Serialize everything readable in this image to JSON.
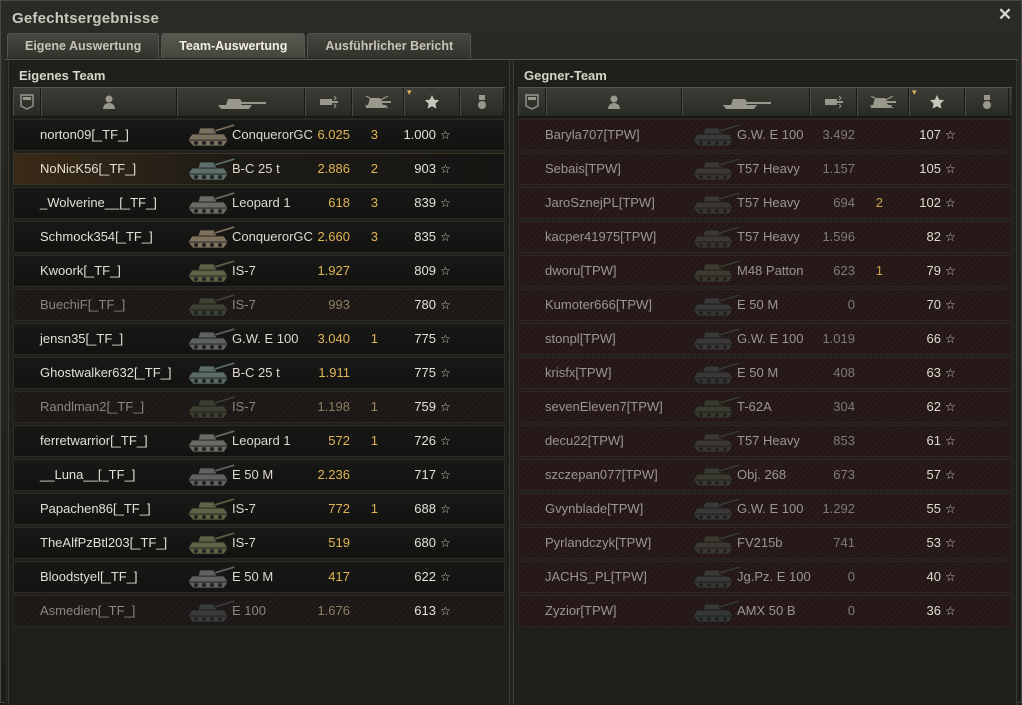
{
  "window": {
    "title": "Gefechtsergebnisse"
  },
  "tabs": [
    {
      "label": "Eigene Auswertung",
      "active": false
    },
    {
      "label": "Team-Auswertung",
      "active": true
    },
    {
      "label": "Ausführlicher Bericht",
      "active": false
    }
  ],
  "header_icons": [
    "squad-icon",
    "player-icon",
    "vehicle-icon",
    "damage-icon",
    "frags-icon",
    "experience-star-icon",
    "medal-icon"
  ],
  "sort": {
    "column": "experience",
    "indicator": "▾"
  },
  "star_glyph": "☆",
  "own_team": {
    "title": "Eigenes Team",
    "players": [
      {
        "name": "norton09[_TF_]",
        "vehicle": "ConquerorGC",
        "damage": "6.025",
        "kills": "3",
        "xp": "1.000",
        "state": "alive",
        "tank_color": "#7a705e"
      },
      {
        "name": "NoNicK56[_TF_]",
        "vehicle": "B-C 25 t",
        "damage": "2.886",
        "kills": "2",
        "xp": "903",
        "state": "me",
        "tank_color": "#5e6e6a"
      },
      {
        "name": "_Wolverine__[_TF_]",
        "vehicle": "Leopard 1",
        "damage": "618",
        "kills": "3",
        "xp": "839",
        "state": "alive",
        "tank_color": "#6a6c64"
      },
      {
        "name": "Schmock354[_TF_]",
        "vehicle": "ConquerorGC",
        "damage": "2.660",
        "kills": "3",
        "xp": "835",
        "state": "alive",
        "tank_color": "#7e725c"
      },
      {
        "name": "Kwoork[_TF_]",
        "vehicle": "IS-7",
        "damage": "1.927",
        "kills": "",
        "xp": "809",
        "state": "alive",
        "tank_color": "#5d6446"
      },
      {
        "name": "BuechiF[_TF_]",
        "vehicle": "IS-7",
        "damage": "993",
        "kills": "",
        "xp": "780",
        "state": "dead",
        "tank_color": "#3e4232"
      },
      {
        "name": "jensn35[_TF_]",
        "vehicle": "G.W. E 100",
        "damage": "3.040",
        "kills": "1",
        "xp": "775",
        "state": "alive",
        "tank_color": "#5f6262"
      },
      {
        "name": "Ghostwalker632[_TF_]",
        "vehicle": "B-C 25 t",
        "damage": "1.911",
        "kills": "",
        "xp": "775",
        "state": "alive",
        "tank_color": "#5c6c68"
      },
      {
        "name": "Randlman2[_TF_]",
        "vehicle": "IS-7",
        "damage": "1.198",
        "kills": "1",
        "xp": "759",
        "state": "dead",
        "tank_color": "#3c4030"
      },
      {
        "name": "ferretwarrior[_TF_]",
        "vehicle": "Leopard 1",
        "damage": "572",
        "kills": "1",
        "xp": "726",
        "state": "alive",
        "tank_color": "#6a6c64"
      },
      {
        "name": "__Luna__[_TF_]",
        "vehicle": "E 50 M",
        "damage": "2.236",
        "kills": "",
        "xp": "717",
        "state": "alive",
        "tank_color": "#606264"
      },
      {
        "name": "Papachen86[_TF_]",
        "vehicle": "IS-7",
        "damage": "772",
        "kills": "1",
        "xp": "688",
        "state": "alive",
        "tank_color": "#5d6446"
      },
      {
        "name": "TheAlfPzBtl203[_TF_]",
        "vehicle": "IS-7",
        "damage": "519",
        "kills": "",
        "xp": "680",
        "state": "alive",
        "tank_color": "#5d6446"
      },
      {
        "name": "Bloodstyel[_TF_]",
        "vehicle": "E 50 M",
        "damage": "417",
        "kills": "",
        "xp": "622",
        "state": "alive",
        "tank_color": "#606264"
      },
      {
        "name": "Asmedien[_TF_]",
        "vehicle": "E 100",
        "damage": "1.676",
        "kills": "",
        "xp": "613",
        "state": "dead",
        "tank_color": "#3a3c3c"
      }
    ]
  },
  "enemy_team": {
    "title": "Gegner-Team",
    "players": [
      {
        "name": "Baryla707[TPW]",
        "vehicle": "G.W. E 100",
        "damage": "3.492",
        "kills": "",
        "xp": "107",
        "state": "enemy",
        "tank_color": "#3a3838"
      },
      {
        "name": "Sebais[TPW]",
        "vehicle": "T57 Heavy",
        "damage": "1.157",
        "kills": "",
        "xp": "105",
        "state": "enemy",
        "tank_color": "#3c3632"
      },
      {
        "name": "JaroSznejPL[TPW]",
        "vehicle": "T57 Heavy",
        "damage": "694",
        "kills": "2",
        "xp": "102",
        "state": "enemy",
        "tank_color": "#3c3632"
      },
      {
        "name": "kacper41975[TPW]",
        "vehicle": "T57 Heavy",
        "damage": "1.596",
        "kills": "",
        "xp": "82",
        "state": "enemy",
        "tank_color": "#3c3632"
      },
      {
        "name": "dworu[TPW]",
        "vehicle": "M48 Patton",
        "damage": "623",
        "kills": "1",
        "xp": "79",
        "state": "enemy",
        "tank_color": "#3e3a30"
      },
      {
        "name": "Kumoter666[TPW]",
        "vehicle": "E 50 M",
        "damage": "0",
        "kills": "",
        "xp": "70",
        "state": "enemy",
        "tank_color": "#383636"
      },
      {
        "name": "stonpl[TPW]",
        "vehicle": "G.W. E 100",
        "damage": "1.019",
        "kills": "",
        "xp": "66",
        "state": "enemy",
        "tank_color": "#3a3838"
      },
      {
        "name": "krisfx[TPW]",
        "vehicle": "E 50 M",
        "damage": "408",
        "kills": "",
        "xp": "63",
        "state": "enemy",
        "tank_color": "#383636"
      },
      {
        "name": "sevenEleven7[TPW]",
        "vehicle": "T-62A",
        "damage": "304",
        "kills": "",
        "xp": "62",
        "state": "enemy",
        "tank_color": "#3a3a2e"
      },
      {
        "name": "decu22[TPW]",
        "vehicle": "T57 Heavy",
        "damage": "853",
        "kills": "",
        "xp": "61",
        "state": "enemy",
        "tank_color": "#3c3632"
      },
      {
        "name": "szczepan077[TPW]",
        "vehicle": "Obj. 268",
        "damage": "673",
        "kills": "",
        "xp": "57",
        "state": "enemy",
        "tank_color": "#3a3a30"
      },
      {
        "name": "Gvynblade[TPW]",
        "vehicle": "G.W. E 100",
        "damage": "1.292",
        "kills": "",
        "xp": "55",
        "state": "enemy",
        "tank_color": "#3a3838"
      },
      {
        "name": "Pyrlandczyk[TPW]",
        "vehicle": "FV215b",
        "damage": "741",
        "kills": "",
        "xp": "53",
        "state": "enemy",
        "tank_color": "#3c3830"
      },
      {
        "name": "JACHS_PL[TPW]",
        "vehicle": "Jg.Pz. E 100",
        "damage": "0",
        "kills": "",
        "xp": "40",
        "state": "enemy",
        "tank_color": "#3a3836"
      },
      {
        "name": "Zyzior[TPW]",
        "vehicle": "AMX 50 B",
        "damage": "0",
        "kills": "",
        "xp": "36",
        "state": "enemy",
        "tank_color": "#363838"
      }
    ]
  }
}
